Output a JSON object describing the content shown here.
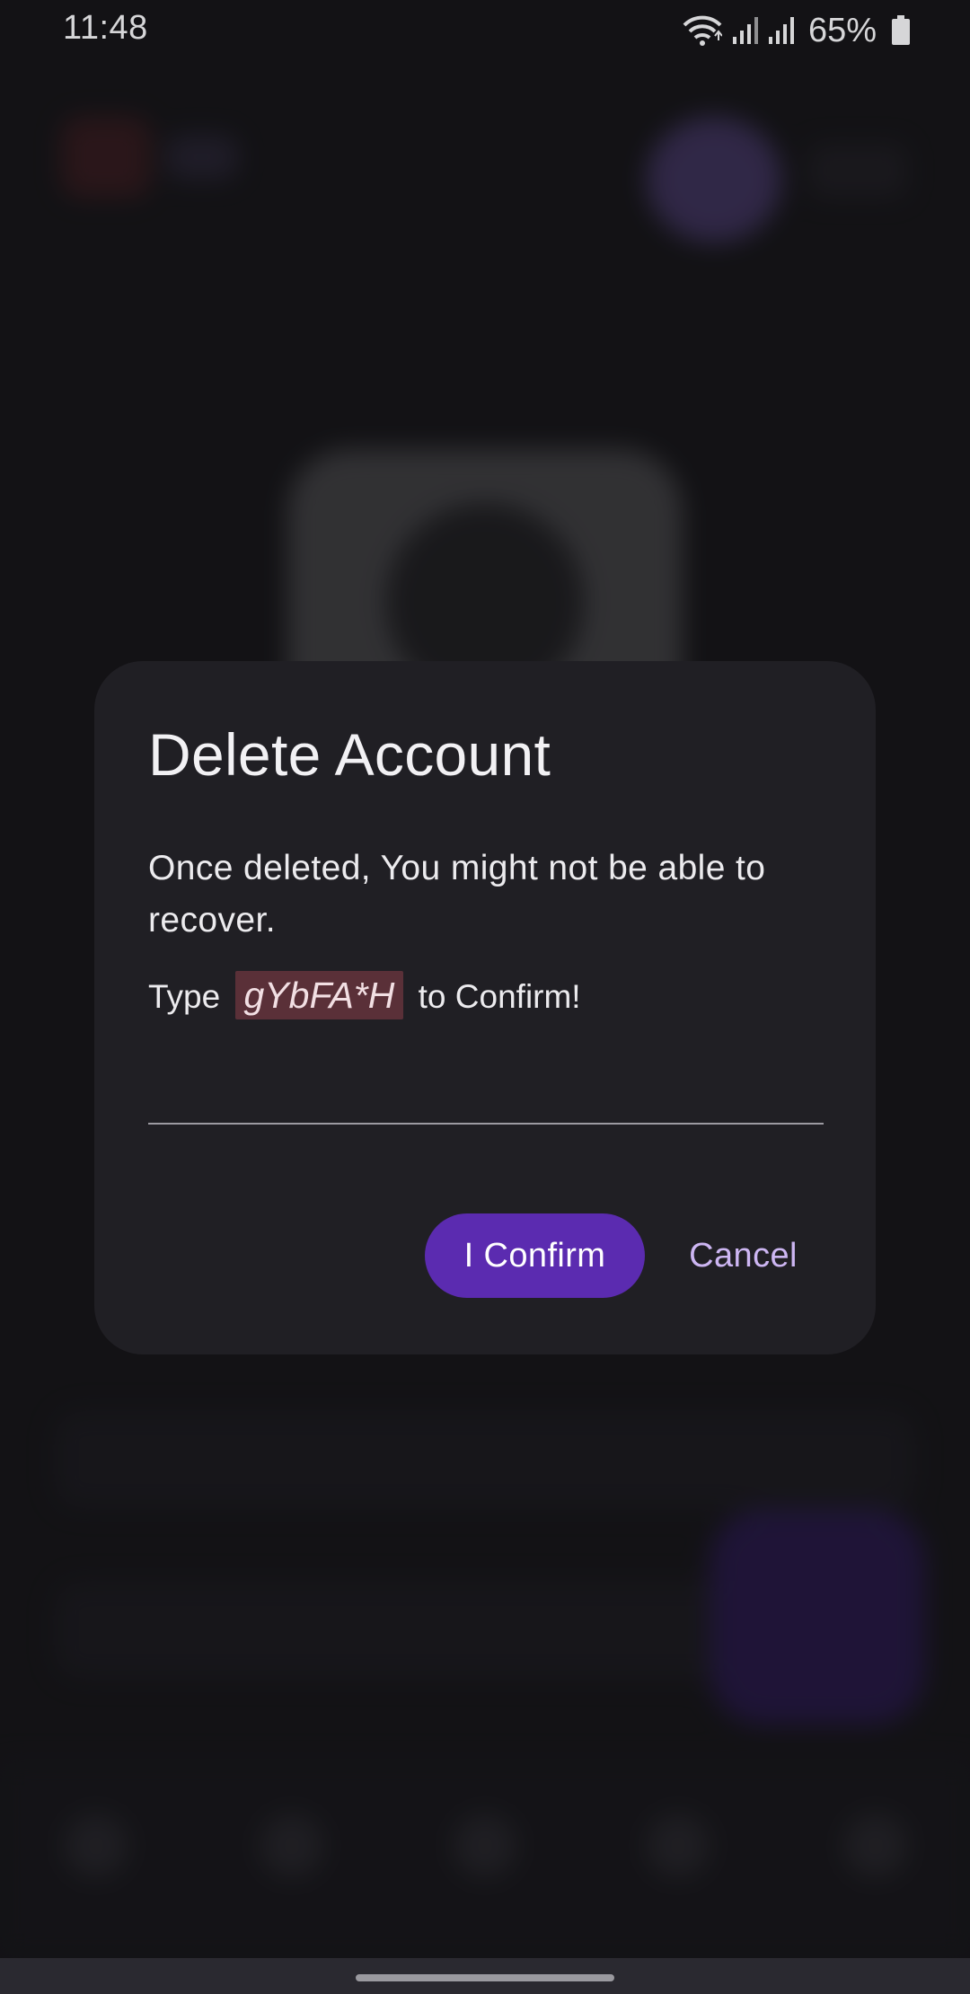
{
  "status_bar": {
    "time": "11:48",
    "battery_percent": "65%",
    "icons": [
      "wifi-icon",
      "signal-icon",
      "signal-icon",
      "battery-icon"
    ]
  },
  "dialog": {
    "title": "Delete Account",
    "message": "Once deleted, You might not be able to recover.",
    "confirm_prefix": "Type",
    "confirm_code": "gYbFA*H",
    "confirm_suffix": "to Confirm!",
    "input_value": "",
    "confirm_button_label": "I Confirm",
    "cancel_button_label": "Cancel"
  },
  "colors": {
    "dialog_background": "#201f24",
    "confirm_button": "#5b2bb0",
    "cancel_text": "#cdb6f3",
    "code_highlight": "#5a3038"
  }
}
